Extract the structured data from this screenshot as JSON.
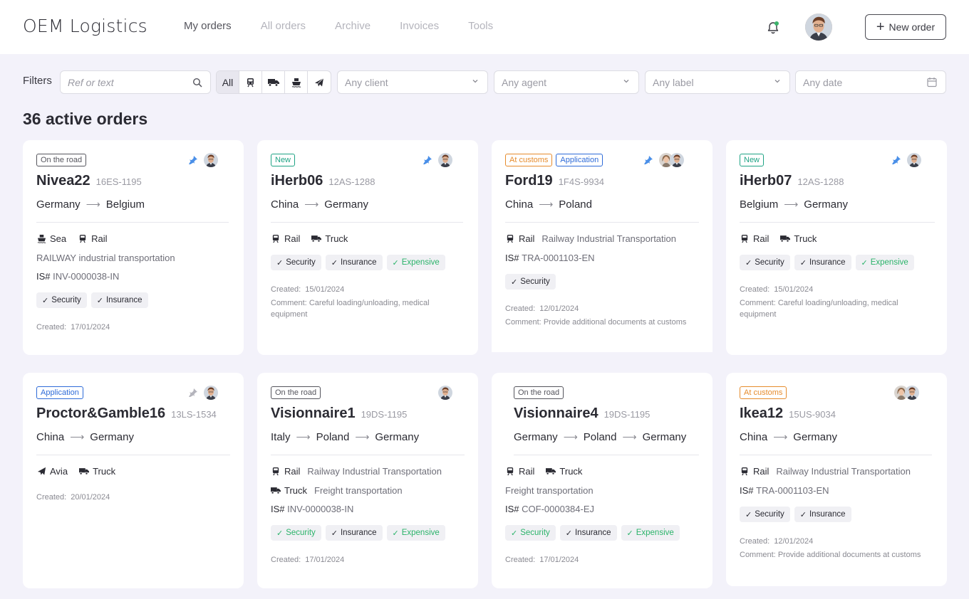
{
  "app": {
    "logo": "OEM Logistics",
    "new_order_label": "New order"
  },
  "nav": [
    {
      "label": "My orders",
      "active": true
    },
    {
      "label": "All orders",
      "active": false
    },
    {
      "label": "Archive",
      "active": false
    },
    {
      "label": "Invoices",
      "active": false
    },
    {
      "label": "Tools",
      "active": false
    }
  ],
  "filters": {
    "label": "Filters",
    "search_placeholder": "Ref or text",
    "mode_all": "All",
    "client": "Any client",
    "agent": "Any agent",
    "tag": "Any label",
    "date": "Any date"
  },
  "summary": {
    "title": "36 active orders"
  },
  "colors": {
    "accent_green": "#2bb36a",
    "new": "#1ea384",
    "customs": "#e68b2c",
    "application": "#2e6bd8",
    "pin_blue": "#4a8fe8"
  },
  "orders": [
    {
      "badges": [
        "On the road"
      ],
      "name": "Nivea22",
      "ref": "16ES-1195",
      "route": [
        "Germany",
        "Belgium"
      ],
      "transport": [
        "Sea",
        "Rail"
      ],
      "transport_desc": "RAILWAY industrial transportation",
      "is_prefix": "IS#",
      "is": "INV-0000038-IN",
      "tags": [
        "Security",
        "Insurance"
      ],
      "created_label": "Created:",
      "created": "17/01/2024"
    },
    {
      "badges": [
        "New"
      ],
      "name": "iHerb06",
      "ref": "12AS-1288",
      "route": [
        "China",
        "Germany"
      ],
      "transport": [
        "Rail",
        "Truck"
      ],
      "tags": [
        "Security",
        "Insurance",
        "Expensive"
      ],
      "created_label": "Created:",
      "created": "15/01/2024",
      "comment_label": "Comment:",
      "comment": "Careful loading/unloading, medical equipment"
    },
    {
      "badges": [
        "At customs",
        "Application"
      ],
      "name": "Ford19",
      "ref": "1F4S-9934",
      "route": [
        "China",
        "Poland"
      ],
      "transport": [
        "Rail"
      ],
      "transport_desc": "Railway Industrial Transportation",
      "is_prefix": "IS#",
      "is": "TRA-0001103-EN",
      "tags": [
        "Security"
      ],
      "created_label": "Created:",
      "created": "12/01/2024",
      "comment_label": "Comment:",
      "comment": "Provide additional documents at customs"
    },
    {
      "badges": [
        "New"
      ],
      "name": "iHerb07",
      "ref": "12AS-1288",
      "route": [
        "Belgium",
        "Germany"
      ],
      "transport": [
        "Rail",
        "Truck"
      ],
      "tags": [
        "Security",
        "Insurance",
        "Expensive"
      ],
      "created_label": "Created:",
      "created": "15/01/2024",
      "comment_label": "Comment:",
      "comment": "Careful loading/unloading, medical equipment"
    },
    {
      "badges": [
        "Application"
      ],
      "name": "Proctor&Gamble16",
      "ref": "13LS-1534",
      "route": [
        "China",
        "Germany"
      ],
      "transport": [
        "Avia",
        "Truck"
      ],
      "created_label": "Created:",
      "created": "20/01/2024"
    },
    {
      "badges": [
        "On the road"
      ],
      "name": "Visionnaire1",
      "ref": "19DS-1195",
      "route": [
        "Italy",
        "Poland",
        "Germany"
      ],
      "transport": [
        "Rail"
      ],
      "transport_desc": "Railway Industrial Transportation",
      "transport2": "Truck",
      "transport2_desc": "Freight transportation",
      "is_prefix": "IS#",
      "is": "INV-0000038-IN",
      "tags": [
        "Security",
        "Insurance",
        "Expensive"
      ],
      "created_label": "Created:",
      "created": "17/01/2024"
    },
    {
      "badges": [
        "On the road"
      ],
      "name": "Visionnaire4",
      "ref": "19DS-1195",
      "route": [
        "Germany",
        "Poland",
        "Germany"
      ],
      "transport": [
        "Rail",
        "Truck"
      ],
      "transport_desc": "Freight transportation",
      "is_prefix": "IS#",
      "is": "COF-0000384-EJ",
      "tags": [
        "Security",
        "Insurance",
        "Expensive"
      ],
      "created_label": "Created:",
      "created": "17/01/2024"
    },
    {
      "badges": [
        "At customs"
      ],
      "name": "Ikea12",
      "ref": "15US-9034",
      "route": [
        "China",
        "Germany"
      ],
      "transport": [
        "Rail"
      ],
      "transport_desc": "Railway Industrial Transportation",
      "is_prefix": "IS#",
      "is": "TRA-0001103-EN",
      "tags": [
        "Security",
        "Insurance"
      ],
      "created_label": "Created:",
      "created": "12/01/2024",
      "comment_label": "Comment:",
      "comment": "Provide additional documents at customs"
    }
  ]
}
